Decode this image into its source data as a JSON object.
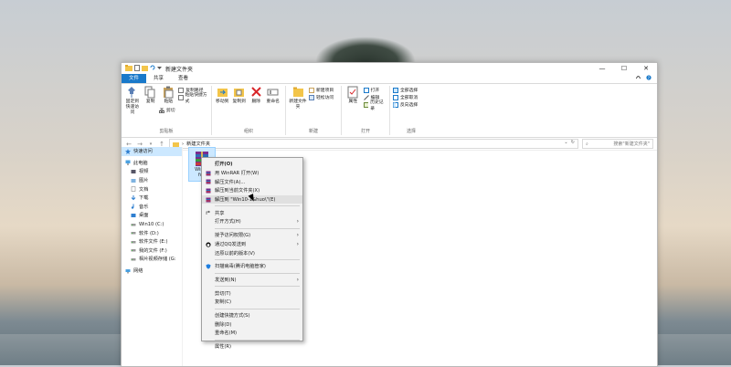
{
  "window": {
    "title": "新建文件夹",
    "controls": {
      "minimize": "—",
      "maximize": "☐",
      "close": "✕"
    }
  },
  "tabs": [
    {
      "label": "文件"
    },
    {
      "label": "共享"
    },
    {
      "label": "查看"
    }
  ],
  "ribbon": {
    "clipboard": {
      "label": "剪贴板",
      "pin": "固定到快速访问",
      "copy": "复制",
      "paste": "粘贴",
      "copy_path": "复制路径",
      "paste_shortcut": "粘贴快捷方式",
      "cut": "剪切"
    },
    "organize": {
      "label": "组织",
      "move_to": "移动到",
      "copy_to": "复制到",
      "delete": "删除",
      "rename": "重命名"
    },
    "new": {
      "label": "新建",
      "new_folder": "新建文件夹",
      "new_item": "新建项目",
      "easy_access": "轻松访问"
    },
    "open": {
      "label": "打开",
      "properties": "属性",
      "open": "打开",
      "edit": "编辑",
      "history": "历史记录"
    },
    "select": {
      "label": "选择",
      "select_all": "全部选择",
      "select_none": "全部取消",
      "invert": "反向选择"
    }
  },
  "address": {
    "path": "新建文件夹",
    "search_placeholder": "搜索\"新建文件夹\""
  },
  "nav": [
    {
      "label": "快速访问",
      "icon": "star-icon",
      "level": 0,
      "selected": true
    },
    {
      "label": "此电脑",
      "icon": "computer-icon",
      "level": 0
    },
    {
      "label": "视频",
      "icon": "video-icon",
      "level": 1
    },
    {
      "label": "图片",
      "icon": "picture-icon",
      "level": 1
    },
    {
      "label": "文档",
      "icon": "document-icon",
      "level": 1
    },
    {
      "label": "下载",
      "icon": "download-icon",
      "level": 1
    },
    {
      "label": "音乐",
      "icon": "music-icon",
      "level": 1
    },
    {
      "label": "桌面",
      "icon": "desktop-icon",
      "level": 1
    },
    {
      "label": "Win10 (C:)",
      "icon": "drive-icon",
      "level": 1
    },
    {
      "label": "软件 (D:)",
      "icon": "drive-icon",
      "level": 1
    },
    {
      "label": "软件文件 (E:)",
      "icon": "drive-icon",
      "level": 1
    },
    {
      "label": "我的文件 (F:)",
      "icon": "drive-icon",
      "level": 1
    },
    {
      "label": "相片视频存储 (G:",
      "icon": "drive-icon",
      "level": 1
    },
    {
      "label": "网络",
      "icon": "network-icon",
      "level": 0
    }
  ],
  "file": {
    "name_line1": "Win10",
    "name_line2": "fuo"
  },
  "context_menu": [
    {
      "label": "打开(O)",
      "bold": true
    },
    {
      "label": "用 WinRAR 打开(W)",
      "icon": "winrar-icon"
    },
    {
      "label": "解压文件(A)...",
      "icon": "winrar-icon"
    },
    {
      "label": "解压到当前文件夹(X)",
      "icon": "winrar-icon"
    },
    {
      "label": "解压到 \"Win10-1&huo\\\"(E)",
      "icon": "winrar-icon",
      "hover": true
    },
    {
      "label": "共享",
      "icon": "share-icon",
      "sep_before": true
    },
    {
      "label": "打开方式(H)",
      "arrow": true
    },
    {
      "label": "授予访问权限(G)",
      "arrow": true,
      "sep_before": true
    },
    {
      "label": "通过QQ发送到",
      "arrow": true,
      "icon": "qq-icon"
    },
    {
      "label": "还原以前的版本(V)"
    },
    {
      "label": "扫描病毒(腾讯电脑管家)",
      "icon": "tencent-shield-icon",
      "sep_before": true
    },
    {
      "label": "发送到(N)",
      "arrow": true,
      "sep_before": true
    },
    {
      "label": "剪切(T)",
      "sep_before": true
    },
    {
      "label": "复制(C)"
    },
    {
      "label": "创建快捷方式(S)",
      "sep_before": true
    },
    {
      "label": "删除(D)"
    },
    {
      "label": "重命名(M)"
    },
    {
      "label": "属性(R)",
      "sep_before": true
    }
  ],
  "colors": {
    "accent": "#1979ca",
    "selection": "#cce8ff",
    "menu_bg": "#f2f2f2"
  }
}
